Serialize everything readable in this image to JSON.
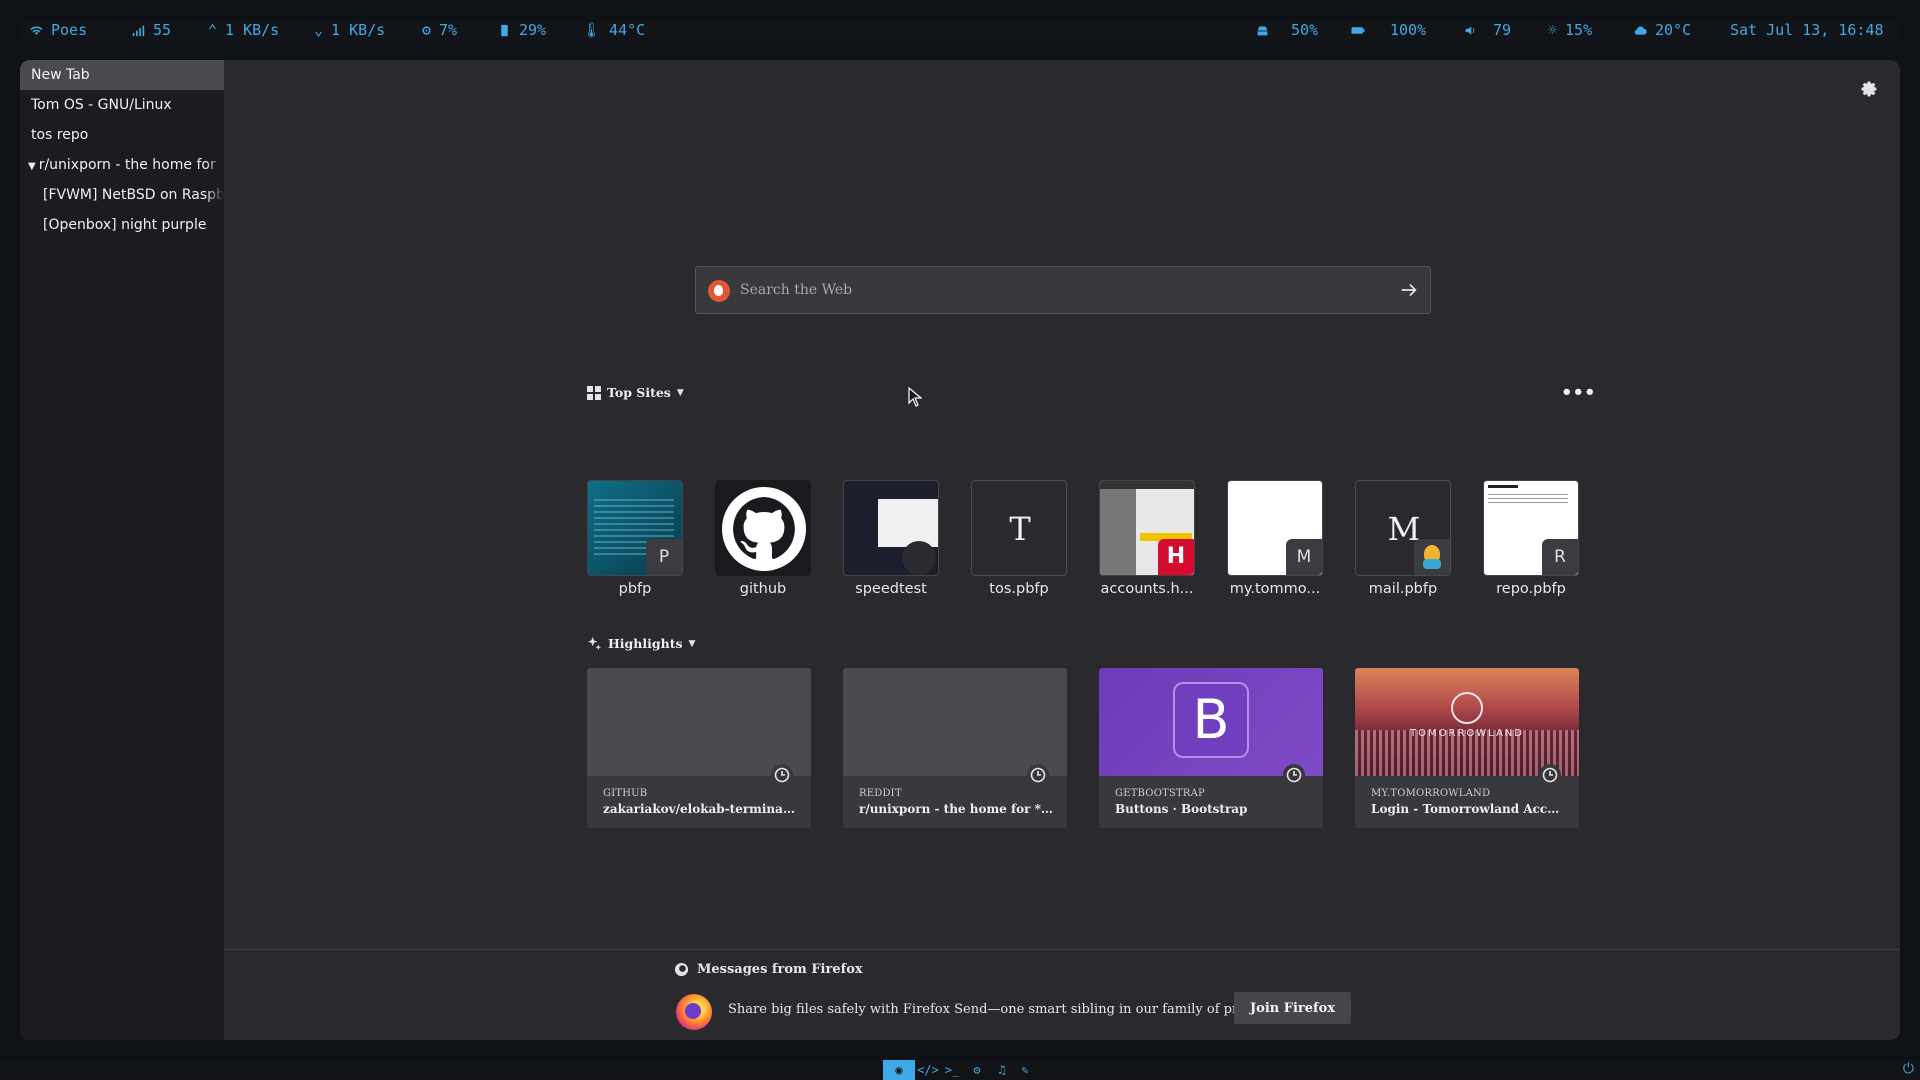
{
  "statusbar": {
    "wifi": "Poes",
    "signal": "55",
    "upload": "1 KB/s",
    "download": "1 KB/s",
    "cpu": "7%",
    "memory": "29%",
    "temperature": "44°C",
    "disk": "50%",
    "battery": "100%",
    "volume": "79",
    "brightness": "15%",
    "weather": "20°C",
    "datetime": "Sat Jul 13, 16:48"
  },
  "sidebar": {
    "items": [
      {
        "label": "New Tab"
      },
      {
        "label": "Tom OS - GNU/Linux"
      },
      {
        "label": "tos repo"
      },
      {
        "label": "r/unixporn - the home for"
      },
      {
        "label": "[FVWM] NetBSD on Raspberry"
      },
      {
        "label": "[Openbox] night purple"
      }
    ]
  },
  "search": {
    "placeholder": "Search the Web"
  },
  "top_sites": {
    "title": "Top Sites",
    "items": [
      {
        "label": "pbfp",
        "badge": "P"
      },
      {
        "label": "github"
      },
      {
        "label": "speedtest"
      },
      {
        "label": "tos.pbfp",
        "letter": "T"
      },
      {
        "label": "accounts.h...",
        "badge": "H"
      },
      {
        "label": "my.tommo...",
        "badge": "M"
      },
      {
        "label": "mail.pbfp",
        "letter": "M"
      },
      {
        "label": "repo.pbfp",
        "badge": "R"
      }
    ]
  },
  "highlights": {
    "title": "Highlights",
    "items": [
      {
        "source": "GITHUB",
        "title": "zakariakov/elokab-terminal: Lig..."
      },
      {
        "source": "REDDIT",
        "title": "r/unixporn - the home for *NIX c..."
      },
      {
        "source": "GETBOOTSTRAP",
        "title": "Buttons · Bootstrap",
        "logo": "B"
      },
      {
        "source": "MY.TOMORROWLAND",
        "title": "Login - Tomorrowland Account",
        "logo": "TOMORROWLAND"
      }
    ]
  },
  "messages": {
    "title": "Messages from Firefox",
    "text": "Share big files safely with Firefox Send—one smart sibling in our family of products.",
    "button": "Join Firefox"
  },
  "colors": {
    "accent": "#3fa8e6",
    "background": "#2a2a2e",
    "sidebar": "#1c1b22"
  }
}
